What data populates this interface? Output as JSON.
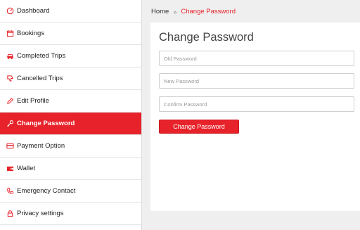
{
  "sidebar": {
    "items": [
      {
        "label": "Dashboard",
        "icon": "dashboard-icon"
      },
      {
        "label": "Bookings",
        "icon": "calendar-icon"
      },
      {
        "label": "Completed Trips",
        "icon": "car-icon"
      },
      {
        "label": "Cancelled Trips",
        "icon": "thumbs-down-icon"
      },
      {
        "label": "Edit Profile",
        "icon": "pencil-icon"
      },
      {
        "label": "Change Password",
        "icon": "key-icon",
        "active": true
      },
      {
        "label": "Payment Option",
        "icon": "credit-card-icon"
      },
      {
        "label": "Wallet",
        "icon": "wallet-icon"
      },
      {
        "label": "Emergency Contact",
        "icon": "phone-icon"
      },
      {
        "label": "Privacy settings",
        "icon": "lock-icon"
      }
    ]
  },
  "breadcrumb": {
    "home": "Home",
    "separator": "»",
    "current": "Change Password"
  },
  "panel": {
    "title": "Change Password",
    "fields": {
      "old_password": {
        "placeholder": "Old Password",
        "value": ""
      },
      "new_password": {
        "placeholder": "New Password",
        "value": ""
      },
      "confirm_password": {
        "placeholder": "Confirm Password",
        "value": ""
      }
    },
    "submit_label": "Change Password"
  },
  "colors": {
    "accent": "#e8222a",
    "background": "#efefef",
    "panel": "#ffffff"
  }
}
